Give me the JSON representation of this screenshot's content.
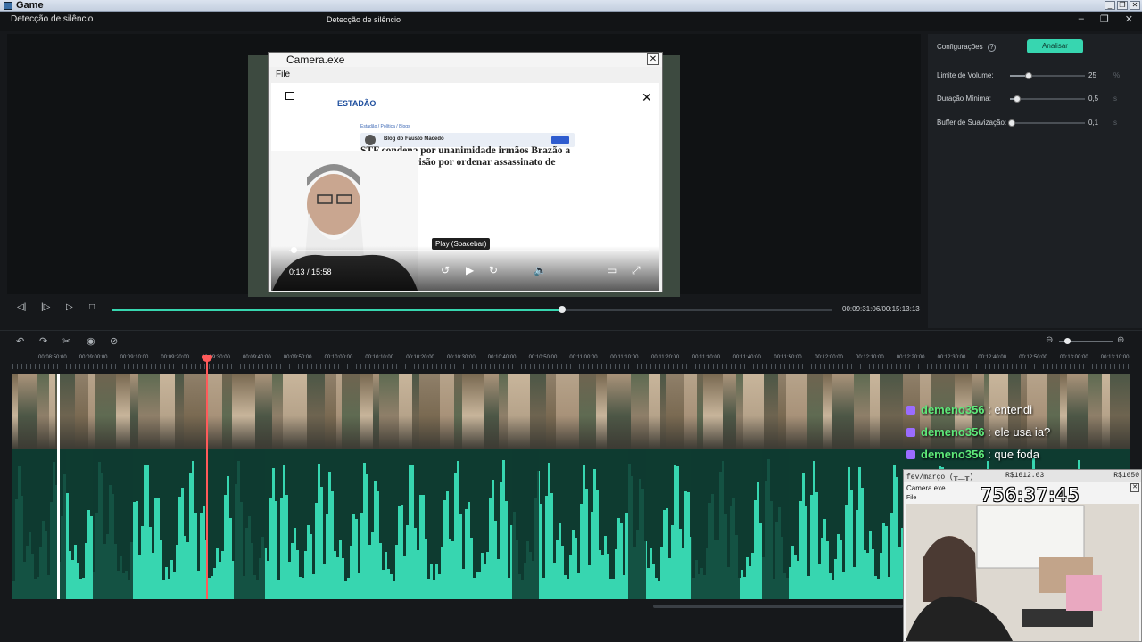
{
  "os": {
    "title": "Game"
  },
  "app": {
    "left_title": "Detecção de silêncio",
    "center_title": "Detecção de silêncio"
  },
  "settings": {
    "header": "Configurações",
    "analyze_label": "Analisar",
    "rows": [
      {
        "label": "Limite de Volume:",
        "value": "25",
        "unit": "%",
        "level": 0.25
      },
      {
        "label": "Duração Mínima:",
        "value": "0,5",
        "unit": "s",
        "level": 0.1
      },
      {
        "label": "Buffer de Suavização:",
        "value": "0,1",
        "unit": "s",
        "level": 0.02
      }
    ]
  },
  "player": {
    "time": "00:09:31:06/00:15:13:13",
    "progress": 0.625
  },
  "ruler_labels": [
    "00:08:50:00",
    "00:09:00:00",
    "00:09:10:00",
    "00:09:20:00",
    "00:09:30:00",
    "00:09:40:00",
    "00:09:50:00",
    "00:10:00:00",
    "00:10:10:00",
    "00:10:20:00",
    "00:10:30:00",
    "00:10:40:00",
    "00:10:50:00",
    "00:11:00:00",
    "00:11:10:00",
    "00:11:20:00",
    "00:11:30:00",
    "00:11:40:00",
    "00:11:50:00",
    "00:12:00:00",
    "00:12:10:00",
    "00:12:20:00",
    "00:12:30:00",
    "00:12:40:00",
    "00:12:50:00",
    "00:13:00:00",
    "00:13:10:00"
  ],
  "chat": [
    {
      "user": "demeno356",
      "message": ": entendi"
    },
    {
      "user": "demeno356",
      "message": ": ele usa ia?"
    },
    {
      "user": "demeno356",
      "message": ": que foda"
    }
  ],
  "camera_window": {
    "title": "Camera.exe",
    "menu_file": "File",
    "logo": "ESTADÃO",
    "breadcrumb": "Estadão / Política / Blogs",
    "blog_name": "Blog do Fausto Macedo",
    "headline": "STF condena por unanimidade irmãos Brazão a 76 anos de prisão por ordenar assassinato de Marielle",
    "tooltip": "Play (Spacebar)",
    "time": "0:13 / 15:58"
  },
  "webcam": {
    "header_left": "fev/março (╥﹏╥)",
    "header_mid": "R$1612.63",
    "header_right": "R$1650",
    "title": "Camera.exe",
    "file": "File",
    "clock": "756:37:45"
  }
}
